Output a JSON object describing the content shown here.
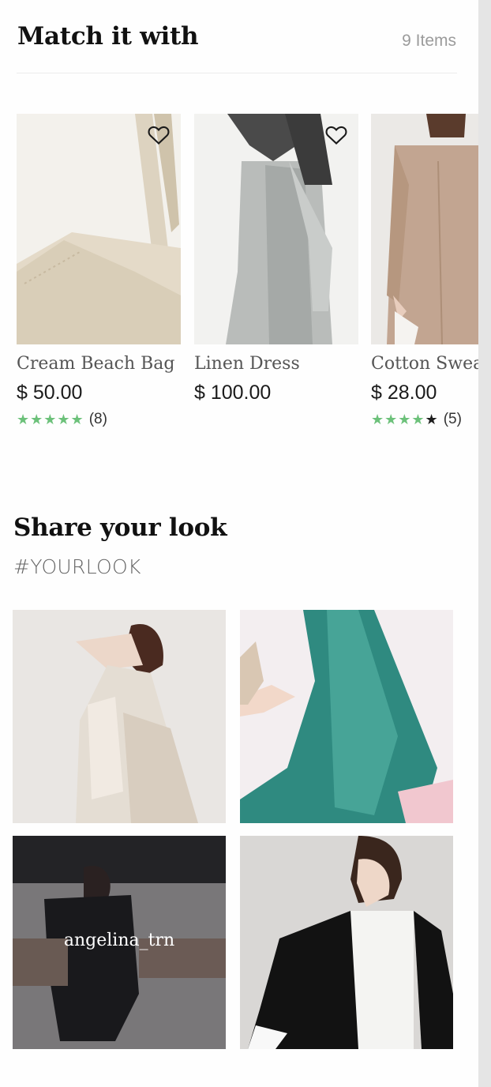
{
  "match": {
    "title": "Match it with",
    "count": "9 Items",
    "products": [
      {
        "name": "Cream Beach Bag",
        "price": "$ 50.00",
        "stars": 5,
        "rating_count": "(8)",
        "favorite_icon": "heart-outline-icon"
      },
      {
        "name": "Linen Dress",
        "price": "$ 100.00",
        "favorite_icon": "heart-outline-icon"
      },
      {
        "name": "Cotton Sweat",
        "price": "$ 28.00",
        "stars": 4,
        "rating_count": "(5)"
      }
    ]
  },
  "share": {
    "title": "Share your look",
    "hashtag": "#YOURLOOK",
    "tiles": [
      {
        "overlay_user": ""
      },
      {
        "overlay_user": ""
      },
      {
        "overlay_user": "angelina_trn"
      },
      {
        "overlay_user": ""
      }
    ]
  },
  "colors": {
    "star": "#6cc17a",
    "muted_text": "#9b9b9b"
  }
}
